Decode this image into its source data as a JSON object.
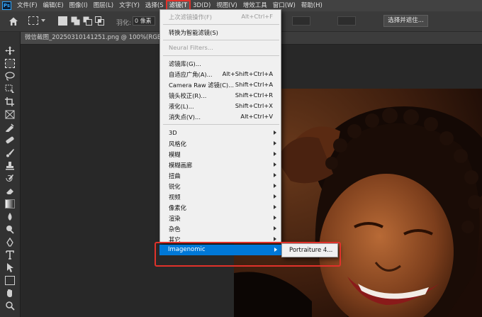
{
  "menubar": {
    "logo": "Ps",
    "items": [
      "文件(F)",
      "编辑(E)",
      "图像(I)",
      "图层(L)",
      "文字(Y)",
      "选择(S",
      "滤镜(T",
      "3D(D)",
      "视图(V)",
      "增效工具",
      "窗口(W)",
      "帮助(H)"
    ],
    "active_index": 6
  },
  "options": {
    "feather_label": "羽化:",
    "feather_value": "0 像素",
    "select_mask_label": "选择并遮住..."
  },
  "document": {
    "tab_title": "微信截图_20250310141251.png @ 100%(RGB/8#)"
  },
  "filter_menu": {
    "last_filter": {
      "label": "上次滤镜操作(F)",
      "shortcut": "Alt+Ctrl+F"
    },
    "convert_smart": "转换为智能滤镜(S)",
    "neural": "Neural Filters...",
    "group_items": [
      {
        "label": "滤镜库(G)...",
        "shortcut": ""
      },
      {
        "label": "自适应广角(A)...",
        "shortcut": "Alt+Shift+Ctrl+A"
      },
      {
        "label": "Camera Raw 滤镜(C)...",
        "shortcut": "Shift+Ctrl+A"
      },
      {
        "label": "镜头校正(R)...",
        "shortcut": "Shift+Ctrl+R"
      },
      {
        "label": "液化(L)...",
        "shortcut": "Shift+Ctrl+X"
      },
      {
        "label": "消失点(V)...",
        "shortcut": "Alt+Ctrl+V"
      }
    ],
    "submenus": [
      "3D",
      "风格化",
      "模糊",
      "模糊画廊",
      "扭曲",
      "锐化",
      "视频",
      "像素化",
      "渲染",
      "杂色",
      "其它"
    ],
    "imagenomic": "Imagenomic"
  },
  "imagenomic_submenu": {
    "item": "Portraiture 4..."
  },
  "icons": {
    "logo": "photoshop-logo-icon",
    "home": "home-icon",
    "submenu_arrow": "chevron-right-icon"
  },
  "colors": {
    "highlight_box": "#e0322b",
    "menu_selection": "#0078d7",
    "app_bg": "#262626"
  }
}
